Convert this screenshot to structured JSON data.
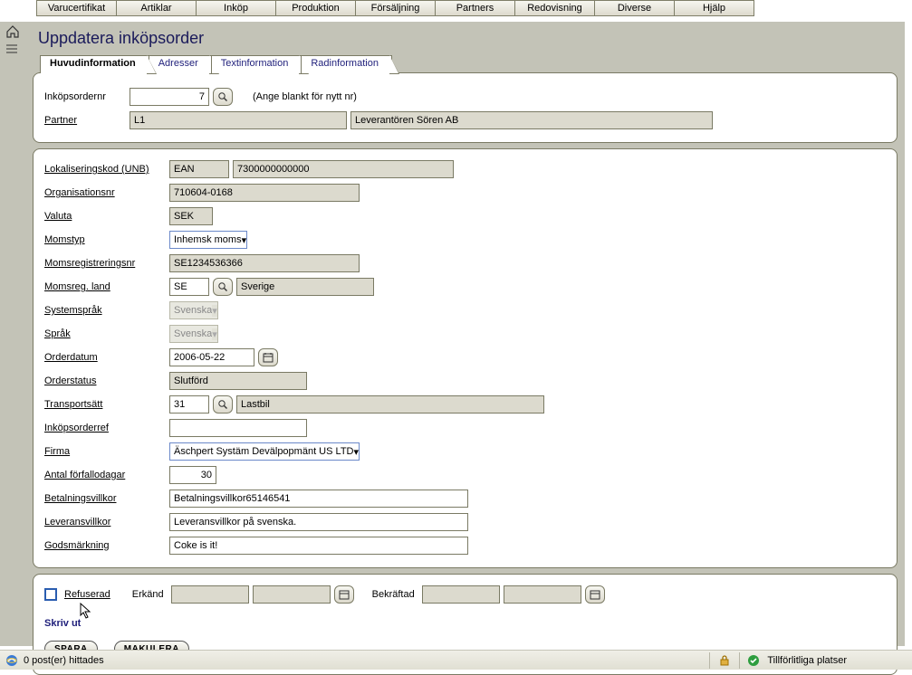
{
  "menu": [
    "Varucertifikat",
    "Artiklar",
    "Inköp",
    "Produktion",
    "Försäljning",
    "Partners",
    "Redovisning",
    "Diverse",
    "Hjälp"
  ],
  "page_title": "Uppdatera inköpsorder",
  "tabs": [
    "Huvudinformation",
    "Adresser",
    "Textinformation",
    "Radinformation"
  ],
  "head": {
    "ordernr_label": "Inköpsordernr",
    "ordernr": "7",
    "ordernr_hint": "(Ange blankt för nytt nr)",
    "partner_label": "Partner",
    "partner_code": "L1",
    "partner_name": "Leverantören Sören AB"
  },
  "form": {
    "unb_label": "Lokaliseringskod (UNB)",
    "unb_code": "EAN",
    "unb_value": "7300000000000",
    "orgnr_label": "Organisationsnr",
    "orgnr": "710604-0168",
    "valuta_label": "Valuta",
    "valuta": "SEK",
    "momstyp_label": "Momstyp",
    "momstyp": "Inhemsk moms",
    "momsreg_label": "Momsregistreringsnr",
    "momsreg": "SE1234536366",
    "momsland_label": "Momsreg. land",
    "momsland_code": "SE",
    "momsland_name": "Sverige",
    "syssprak_label": "Systemspråk",
    "syssprak": "Svenska",
    "sprak_label": "Språk",
    "sprak": "Svenska",
    "orderdatum_label": "Orderdatum",
    "orderdatum": "2006-05-22",
    "orderstatus_label": "Orderstatus",
    "orderstatus": "Slutförd",
    "transport_label": "Transportsätt",
    "transport_code": "31",
    "transport_name": "Lastbil",
    "inkopref_label": "Inköpsorderref",
    "inkopref": "",
    "firma_label": "Firma",
    "firma": "Äschpert Systäm Devälpopmänt US LTD",
    "forfallo_label": "Antal förfallodagar",
    "forfallo": "30",
    "betvillkor_label": "Betalningsvillkor",
    "betvillkor": "Betalningsvillkor65146541",
    "levvillkor_label": "Leveransvillkor",
    "levvillkor": "Leveransvillkor på svenska.",
    "gods_label": "Godsmärkning",
    "gods": "Coke is it!"
  },
  "foot": {
    "refuserad_label": "Refuserad",
    "erkand_label": "Erkänd",
    "bekraftad_label": "Bekräftad",
    "skrivut": "Skriv ut",
    "spara": "SPARA",
    "makulera": "MAKULERA"
  },
  "status": {
    "text": "0 post(er) hittades",
    "trust": "Tillförlitliga platser"
  }
}
